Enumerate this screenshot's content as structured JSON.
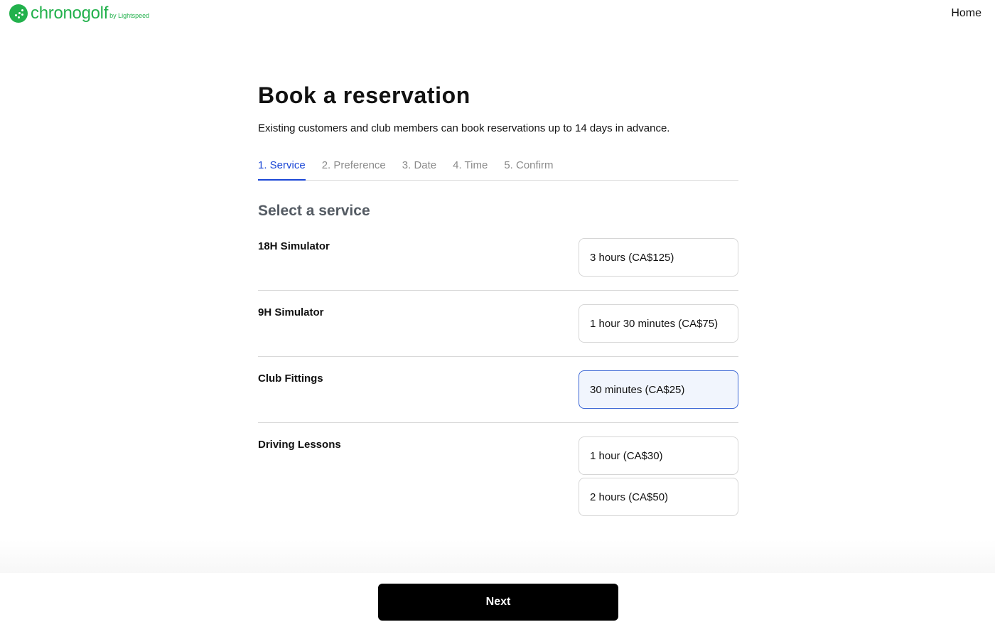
{
  "header": {
    "brand": "chronogolf",
    "brand_by": "by Lightspeed",
    "home_label": "Home"
  },
  "page": {
    "title": "Book a reservation",
    "subtitle": "Existing customers and club members can book reservations up to 14 days in advance."
  },
  "steps": [
    {
      "label": "1. Service",
      "active": true
    },
    {
      "label": "2. Preference",
      "active": false
    },
    {
      "label": "3. Date",
      "active": false
    },
    {
      "label": "4. Time",
      "active": false
    },
    {
      "label": "5. Confirm",
      "active": false
    }
  ],
  "section_title": "Select a service",
  "services": [
    {
      "name": "18H Simulator",
      "options": [
        {
          "label": "3 hours (CA$125)",
          "selected": false
        }
      ]
    },
    {
      "name": "9H Simulator",
      "options": [
        {
          "label": "1 hour 30 minutes (CA$75)",
          "selected": false
        }
      ]
    },
    {
      "name": "Club Fittings",
      "options": [
        {
          "label": "30 minutes (CA$25)",
          "selected": true
        }
      ]
    },
    {
      "name": "Driving Lessons",
      "options": [
        {
          "label": "1 hour (CA$30)",
          "selected": false
        },
        {
          "label": "2 hours (CA$50)",
          "selected": false
        }
      ]
    }
  ],
  "footer": {
    "next_label": "Next"
  },
  "colors": {
    "brand": "#22b14c",
    "active_step": "#1a46d6",
    "selected_border": "#3b66d4",
    "selected_bg": "#f1f5fd"
  }
}
